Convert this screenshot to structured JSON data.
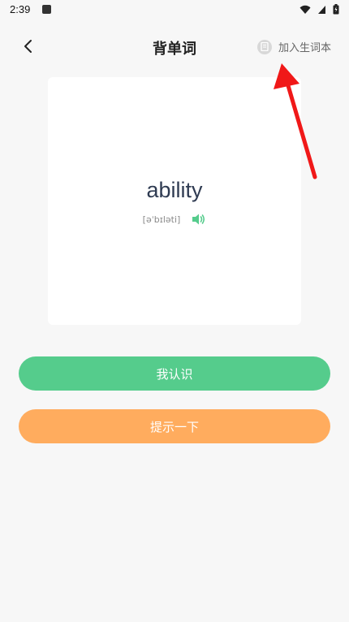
{
  "status_bar": {
    "time": "2:39"
  },
  "header": {
    "title": "背单词",
    "add_vocab_label": "加入生词本"
  },
  "card": {
    "word": "ability",
    "phonetic": "[əˈbɪləti]"
  },
  "buttons": {
    "know_label": "我认识",
    "hint_label": "提示一下"
  },
  "colors": {
    "background": "#f7f7f7",
    "card": "#ffffff",
    "know_button": "#55cc8c",
    "hint_button": "#ffac5e",
    "speaker_icon": "#55cc8c",
    "annotation_arrow": "#f01818"
  },
  "icons": {
    "back": "chevron-left-icon",
    "add_vocab": "notebook-icon",
    "speaker": "speaker-icon",
    "wifi": "wifi-icon",
    "signal": "cell-signal-icon",
    "battery": "battery-icon"
  }
}
